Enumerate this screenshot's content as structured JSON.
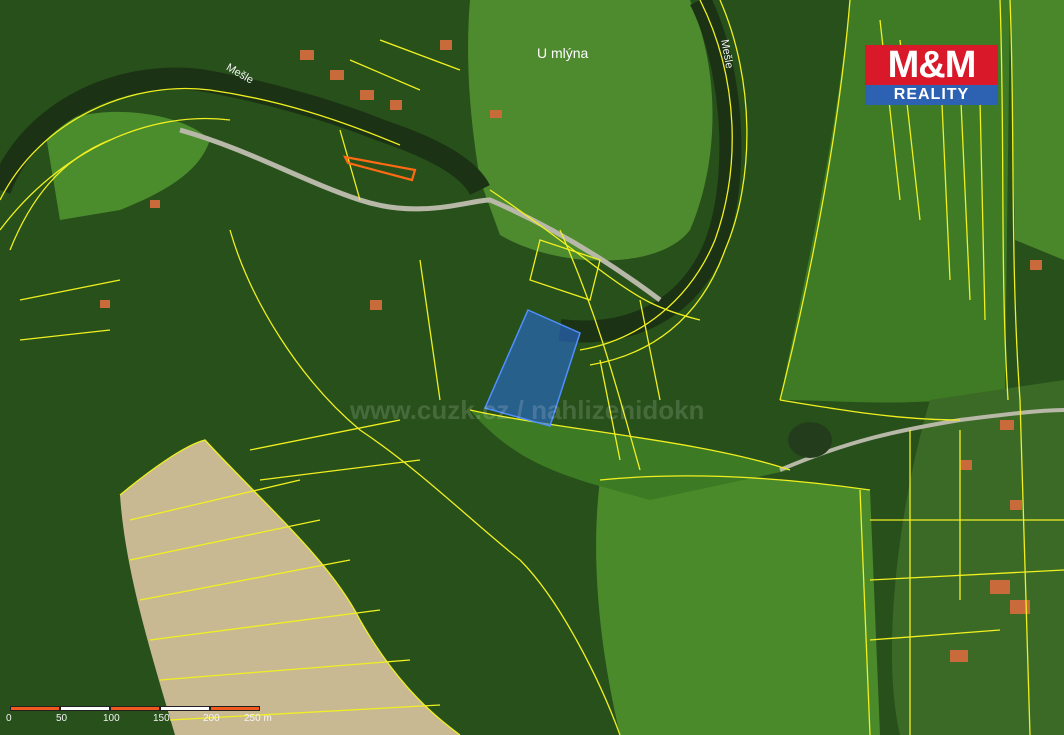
{
  "map": {
    "labels": {
      "locality": "U mlýna",
      "river_left": "Mešle",
      "river_right": "Mešle"
    },
    "logo": {
      "brand": "M&M",
      "sub": "REALITY",
      "colors": {
        "brand_bg": "#d9182a",
        "sub_bg": "#2d62b2"
      }
    },
    "scale": {
      "ticks": [
        "0",
        "50",
        "100",
        "150",
        "200",
        "250 m"
      ],
      "colors": {
        "dark": "#f05a1e",
        "light": "#ffffff"
      }
    },
    "colors": {
      "parcel_lines": "#f0f020",
      "highlight_parcel": "#2a6bd8",
      "highlight_boundary": "#ff6a14",
      "forest": "#1f4a17",
      "meadow": "#4a8a2a",
      "field": "#c8b890"
    },
    "watermark": "www.cuzk.cz / nahlizenidokn"
  }
}
